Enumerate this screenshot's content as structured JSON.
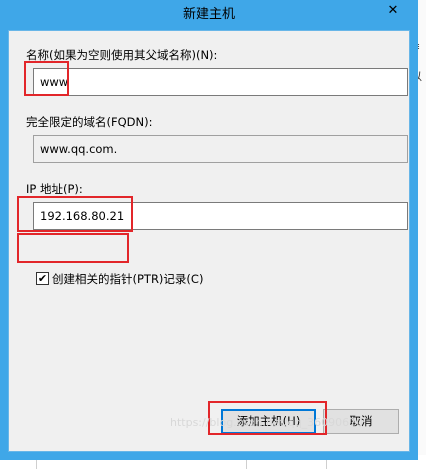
{
  "dialog": {
    "title": "新建主机",
    "close_glyph": "✕",
    "name_label": "名称(如果为空则使用其父域名称)(N):",
    "name_value": "www",
    "fqdn_label": "完全限定的域名(FQDN):",
    "fqdn_value": "www.qq.com.",
    "ip_label": "IP 地址(P):",
    "ip_value": "192.168.80.21",
    "ptr_checkbox_label": "创建相关的指针(PTR)记录(C)",
    "ptr_checked": true,
    "add_button": "添加主机(H)",
    "cancel_button": "取消"
  },
  "background": {
    "right_fragment_1": "≡",
    "right_fragment_2": "以",
    "right_fragment_3": "1"
  },
  "watermark": "https://blog.csdn.net/qq_36090670",
  "colors": {
    "titlebar": "#3fa7e8",
    "annotation_red": "#e2262a",
    "client_bg": "#f0f0f0"
  }
}
